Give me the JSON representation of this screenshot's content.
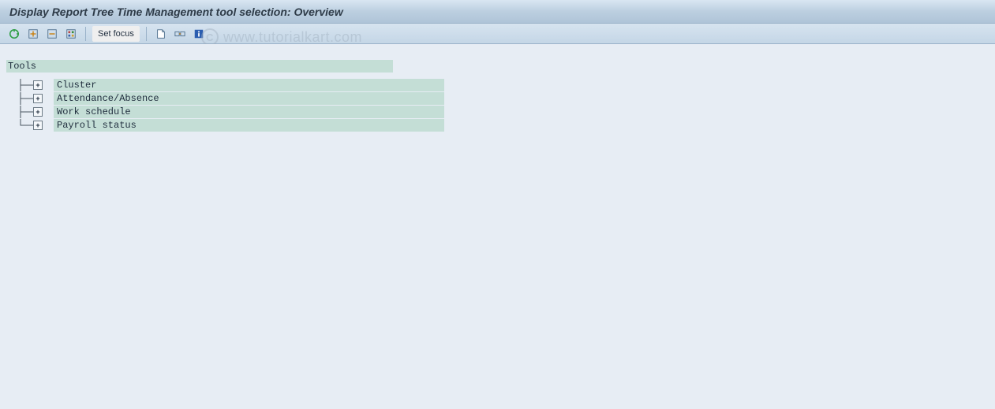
{
  "titlebar": {
    "title": "Display Report Tree Time Management tool selection: Overview"
  },
  "toolbar": {
    "set_focus_label": "Set focus"
  },
  "tree": {
    "root_label": "Tools",
    "items": [
      {
        "label": "Cluster"
      },
      {
        "label": "Attendance/Absence"
      },
      {
        "label": "Work schedule"
      },
      {
        "label": "Payroll status"
      }
    ]
  },
  "watermark": {
    "copyright_symbol": "C",
    "text": "www.tutorialkart.com"
  }
}
